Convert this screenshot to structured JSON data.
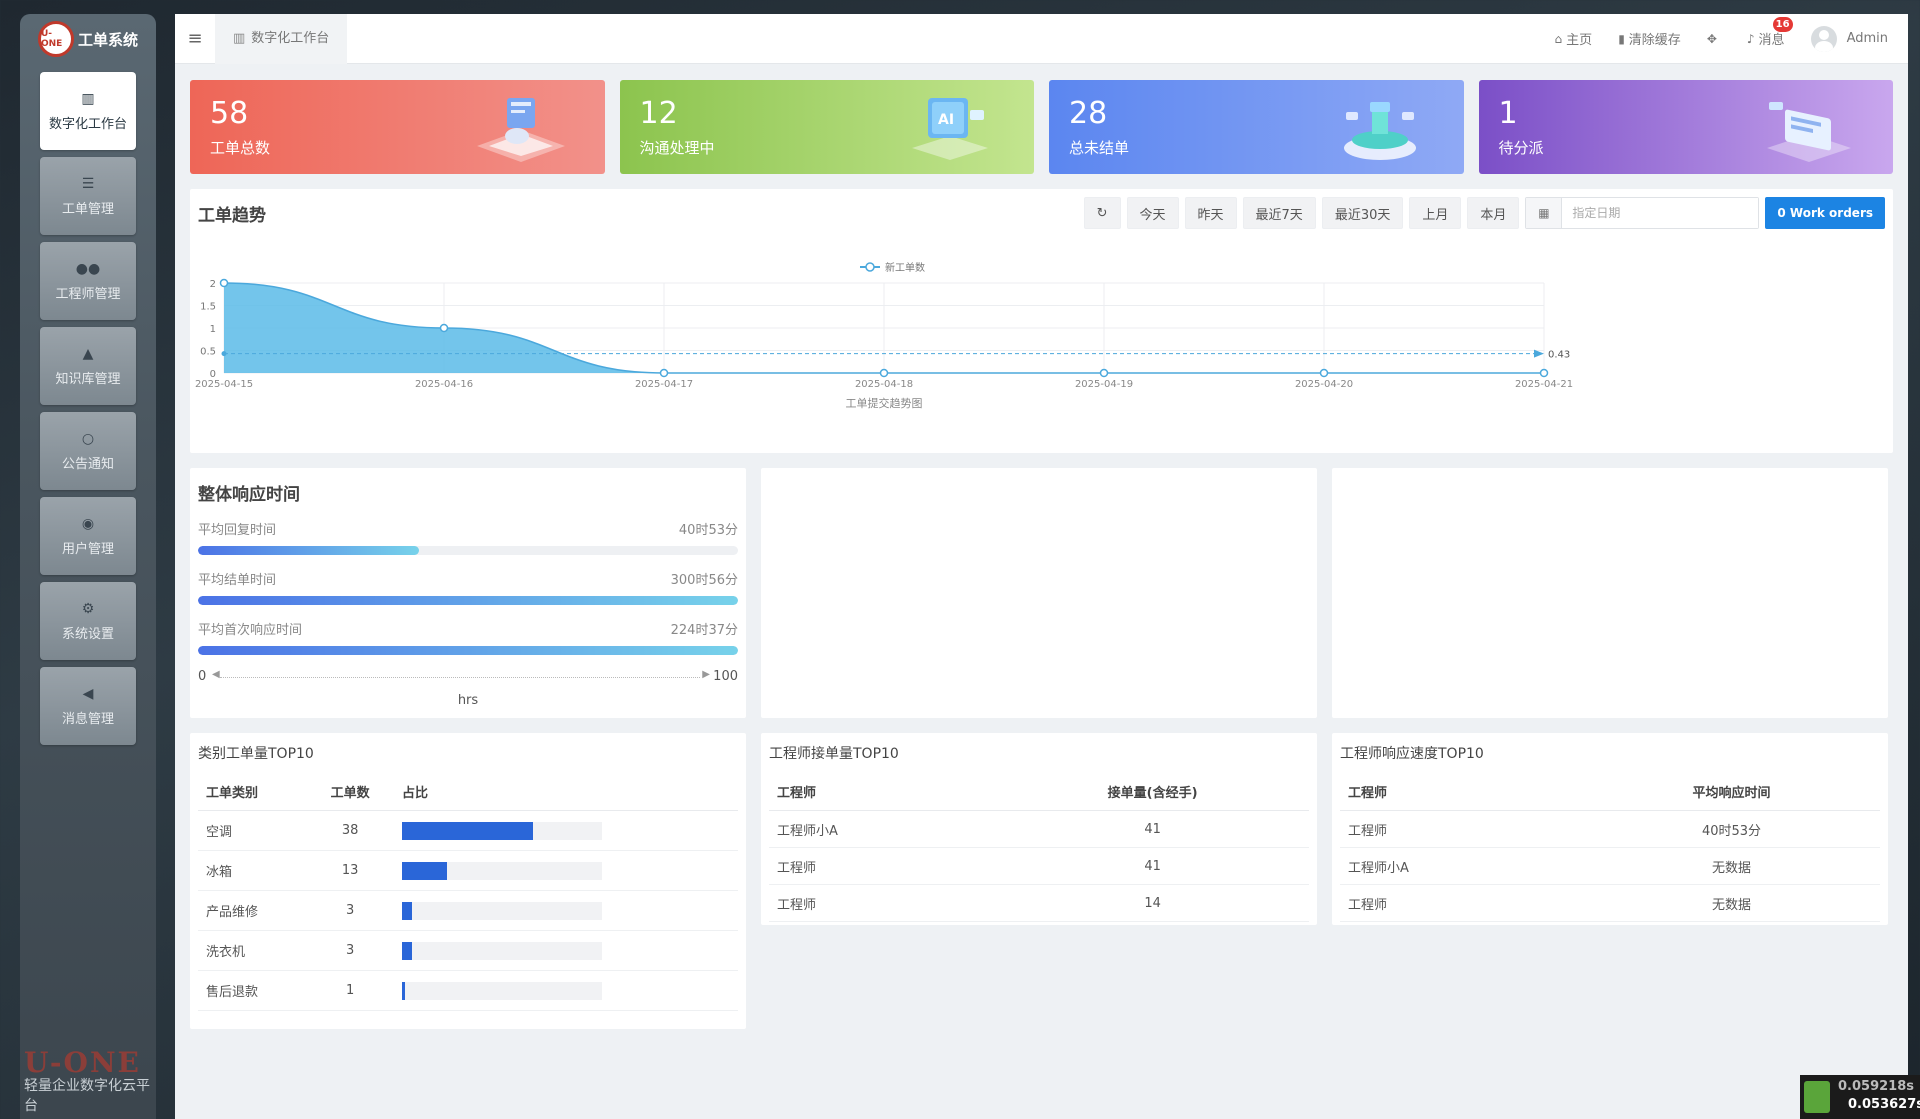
{
  "brand": {
    "logo": "U-ONE",
    "title": "工单系统"
  },
  "sidebar": {
    "items": [
      {
        "label": "数字化工作台",
        "icon": "bar-chart-icon",
        "glyph": "▥",
        "active": true
      },
      {
        "label": "工单管理",
        "icon": "list-icon",
        "glyph": "☰",
        "active": false
      },
      {
        "label": "工程师管理",
        "icon": "users-icon",
        "glyph": "●●",
        "active": false
      },
      {
        "label": "知识库管理",
        "icon": "graduation-cap-icon",
        "glyph": "▲",
        "active": false
      },
      {
        "label": "公告通知",
        "icon": "circle-icon",
        "glyph": "○",
        "active": false
      },
      {
        "label": "用户管理",
        "icon": "user-circle-icon",
        "glyph": "◉",
        "active": false
      },
      {
        "label": "系统设置",
        "icon": "cogs-icon",
        "glyph": "⚙",
        "active": false
      },
      {
        "label": "消息管理",
        "icon": "bullhorn-icon",
        "glyph": "◀",
        "active": false
      }
    ],
    "footer_logo": "U-ONE",
    "footer_text": "轻量企业数字化云平台"
  },
  "topbar": {
    "tab": "数字化工作台",
    "home": "主页",
    "clear_cache": "清除缓存",
    "messages": "消息",
    "message_count": "16",
    "user": "Admin"
  },
  "stats": [
    {
      "value": "58",
      "label": "工单总数"
    },
    {
      "value": "12",
      "label": "沟通处理中"
    },
    {
      "value": "28",
      "label": "总未结单"
    },
    {
      "value": "1",
      "label": "待分派"
    }
  ],
  "trend": {
    "title": "工单趋势",
    "filters": [
      "今天",
      "昨天",
      "最近7天",
      "最近30天",
      "上月",
      "本月"
    ],
    "date_placeholder": "指定日期",
    "work_orders_button": "0 Work orders"
  },
  "chart_data": {
    "type": "area",
    "legend": "新工单数",
    "xlabel": "工单提交趋势图",
    "x": [
      "2025-04-15",
      "2025-04-16",
      "2025-04-17",
      "2025-04-18",
      "2025-04-19",
      "2025-04-20",
      "2025-04-21"
    ],
    "series": [
      {
        "name": "新工单数",
        "values": [
          2,
          1,
          0,
          0,
          0,
          0,
          0
        ]
      }
    ],
    "y_ticks": [
      "0",
      "0.5",
      "1",
      "1.5",
      "2"
    ],
    "ylim": [
      0,
      2
    ],
    "mark_line": {
      "value": 0.43,
      "label": "0.43"
    },
    "color": "#5bbbe8"
  },
  "response": {
    "title": "整体响应时间",
    "rows": [
      {
        "label": "平均回复时间",
        "value": "40时53分",
        "pct": 41
      },
      {
        "label": "平均结单时间",
        "value": "300时56分",
        "pct": 100
      },
      {
        "label": "平均首次响应时间",
        "value": "224时37分",
        "pct": 100
      }
    ],
    "scale_min": "0",
    "scale_max": "100",
    "unit": "hrs"
  },
  "category_table": {
    "title": "类别工单量TOP10",
    "headers": [
      "工单类别",
      "工单数",
      "占比"
    ],
    "rows": [
      {
        "name": "空调",
        "count": "38",
        "ratio": 0.655
      },
      {
        "name": "冰箱",
        "count": "13",
        "ratio": 0.224
      },
      {
        "name": "产品维修",
        "count": "3",
        "ratio": 0.052
      },
      {
        "name": "洗衣机",
        "count": "3",
        "ratio": 0.052
      },
      {
        "name": "售后退款",
        "count": "1",
        "ratio": 0.017
      }
    ]
  },
  "engineer_table": {
    "title": "工程师接单量TOP10",
    "headers": [
      "工程师",
      "接单量(含经手)"
    ],
    "rows": [
      {
        "name": "工程师小A",
        "count": "41"
      },
      {
        "name": "工程师",
        "count": "41"
      },
      {
        "name": "工程师",
        "count": "14"
      }
    ]
  },
  "speed_table": {
    "title": "工程师响应速度TOP10",
    "headers": [
      "工程师",
      "平均响应时间"
    ],
    "rows": [
      {
        "name": "工程师",
        "time": "40时53分"
      },
      {
        "name": "工程师小A",
        "time": "无数据"
      },
      {
        "name": "工程师",
        "time": "无数据"
      }
    ]
  },
  "perf": {
    "t1": "0.059218s",
    "t2": "0.053627s"
  }
}
